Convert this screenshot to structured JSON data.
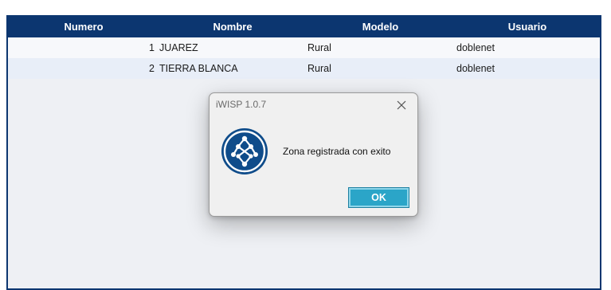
{
  "table": {
    "headers": [
      "Numero",
      "Nombre",
      "Modelo",
      "Usuario"
    ],
    "rows": [
      {
        "numero": "1",
        "nombre": "JUAREZ",
        "modelo": "Rural",
        "usuario": "doblenet"
      },
      {
        "numero": "2",
        "nombre": "TIERRA BLANCA",
        "modelo": "Rural",
        "usuario": "doblenet"
      }
    ]
  },
  "dialog": {
    "title": "iWISP 1.0.7",
    "message": "Zona registrada con exito",
    "ok_label": "OK",
    "icon": "network-nodes-icon",
    "close_icon": "close-icon"
  },
  "colors": {
    "header_bg": "#0c3670",
    "button_bg": "#2ba5c8",
    "icon_bg": "#0f4c8a"
  }
}
